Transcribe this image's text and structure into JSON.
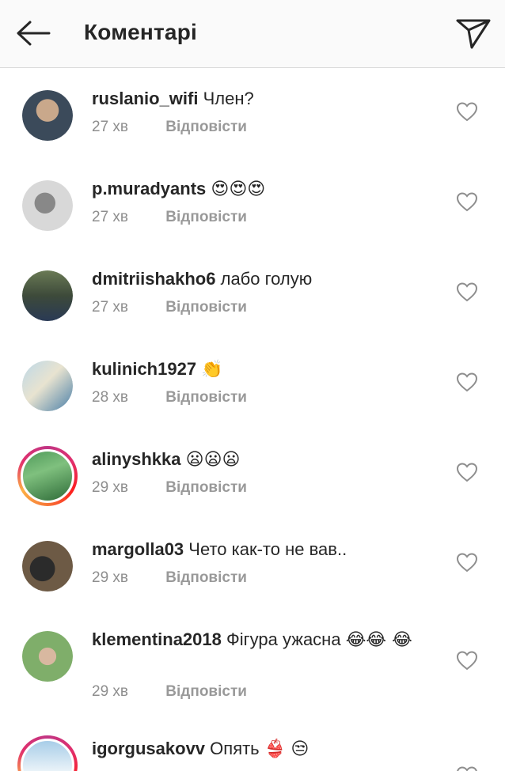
{
  "header": {
    "title": "Коментарі",
    "back_icon": "arrow-left-icon",
    "send_icon": "paper-plane-icon"
  },
  "colors": {
    "text": "#262626",
    "meta": "#8e8e8e",
    "divider": "#dbdbdb",
    "header_bg": "#fafafa"
  },
  "comments": [
    {
      "username": "ruslanio_wifi",
      "text": "Член?",
      "time": "27 хв",
      "reply": "Відповісти",
      "story": false,
      "emoji": []
    },
    {
      "username": "p.muradyants",
      "text": "",
      "time": "27 хв",
      "reply": "Відповісти",
      "story": false,
      "emoji": [
        "heart-eyes",
        "heart-eyes",
        "heart-eyes"
      ]
    },
    {
      "username": "dmitriishakho6",
      "text": "лабо голую",
      "time": "27 хв",
      "reply": "Відповісти",
      "story": false,
      "emoji": []
    },
    {
      "username": "kulinich1927",
      "text": "",
      "time": "28 хв",
      "reply": "Відповісти",
      "story": false,
      "emoji": [
        "clapping-hand"
      ]
    },
    {
      "username": "alinyshkka",
      "text": "",
      "time": "29 хв",
      "reply": "Відповісти",
      "story": true,
      "emoji": [
        "frowning",
        "frowning",
        "frowning"
      ]
    },
    {
      "username": "margolla03",
      "text": "Чето как-то не вав..",
      "time": "29 хв",
      "reply": "Відповісти",
      "story": false,
      "emoji": []
    },
    {
      "username": "klementina2018",
      "text": "Фігура ужасна",
      "time": "29 хв",
      "reply": "Відповісти",
      "story": false,
      "emoji": [
        "tears-of-joy",
        "tears-of-joy",
        "tears-of-joy"
      ]
    },
    {
      "username": "igorgusakovv",
      "text": "Опять",
      "time": "",
      "reply": "",
      "story": true,
      "emoji": [
        "bikini",
        "unamused"
      ]
    }
  ]
}
